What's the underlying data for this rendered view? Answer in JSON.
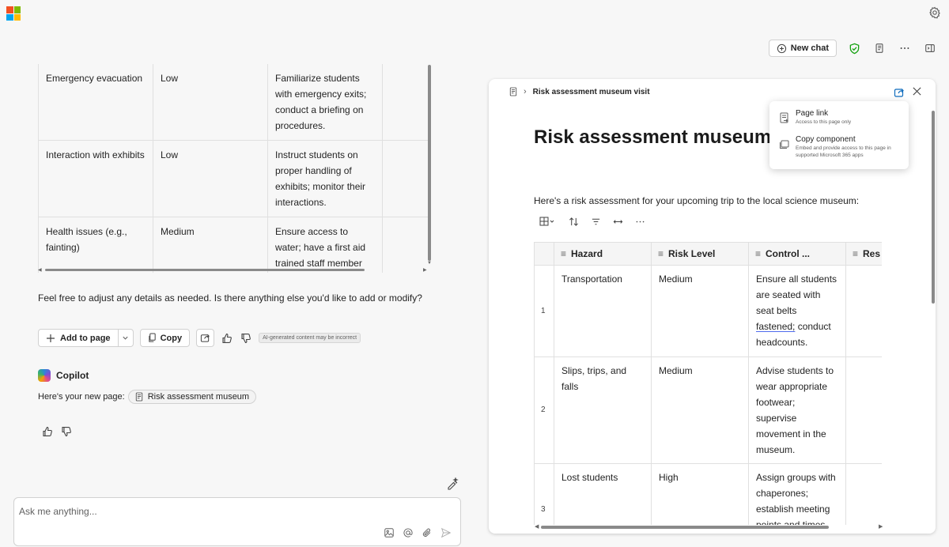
{
  "top_bar": {
    "logo_colors": [
      "#f25022",
      "#7fba00",
      "#00a4ef",
      "#ffb900"
    ],
    "new_chat_label": "New chat"
  },
  "chat": {
    "table_rows": [
      {
        "hazard": "Emergency evacuation",
        "risk": "Low",
        "control": "Familiarize students with emergency exits; conduct a briefing on procedures."
      },
      {
        "hazard": "Interaction with exhibits",
        "risk": "Low",
        "control": "Instruct students on proper handling of exhibits; monitor their interactions."
      },
      {
        "hazard": "Health issues (e.g., fainting)",
        "risk": "Medium",
        "control": "Ensure access to water; have a first aid trained staff member present."
      }
    ],
    "followup_text": "Feel free to adjust any details as needed. Is there anything else you'd like to add or modify?",
    "add_to_page_label": "Add to page",
    "copy_label": "Copy",
    "ai_disclaimer": "AI-generated content may be incorrect",
    "copilot_name": "Copilot",
    "new_page_text": "Here's your new page:",
    "page_chip_label": "Risk assessment museum",
    "input_placeholder": "Ask me anything..."
  },
  "page_panel": {
    "breadcrumb": "Risk assessment museum visit",
    "title": "Risk assessment museum vi",
    "intro": "Here's a risk assessment for your upcoming trip to the local science museum:",
    "columns": [
      "Hazard",
      "Risk Level",
      "Control ...",
      "Res"
    ],
    "rows": [
      {
        "num": "1",
        "hazard": "Transportation",
        "risk": "Medium",
        "control_before": "Ensure all students are seated with seat belts ",
        "control_underlined": "fastened;",
        "control_after": " conduct headcounts."
      },
      {
        "num": "2",
        "hazard": "Slips, trips, and falls",
        "risk": "Medium",
        "control_before": "Advise students to wear appropriate footwear; supervise movement in the museum.",
        "control_underlined": "",
        "control_after": ""
      },
      {
        "num": "3",
        "hazard": "Lost students",
        "risk": "High",
        "control_before": "Assign groups with chaperones; establish meeting points and times.",
        "control_underlined": "",
        "control_after": ""
      }
    ]
  },
  "share_menu": {
    "items": [
      {
        "label": "Page link",
        "desc": "Access to this page only"
      },
      {
        "label": "Copy component",
        "desc": "Embed and provide access to this page in supported Microsoft 365 apps"
      }
    ]
  },
  "colors": {
    "shield_green": "#13a10e",
    "share_blue": "#0f6cbd",
    "background": "#f7f7f7"
  }
}
